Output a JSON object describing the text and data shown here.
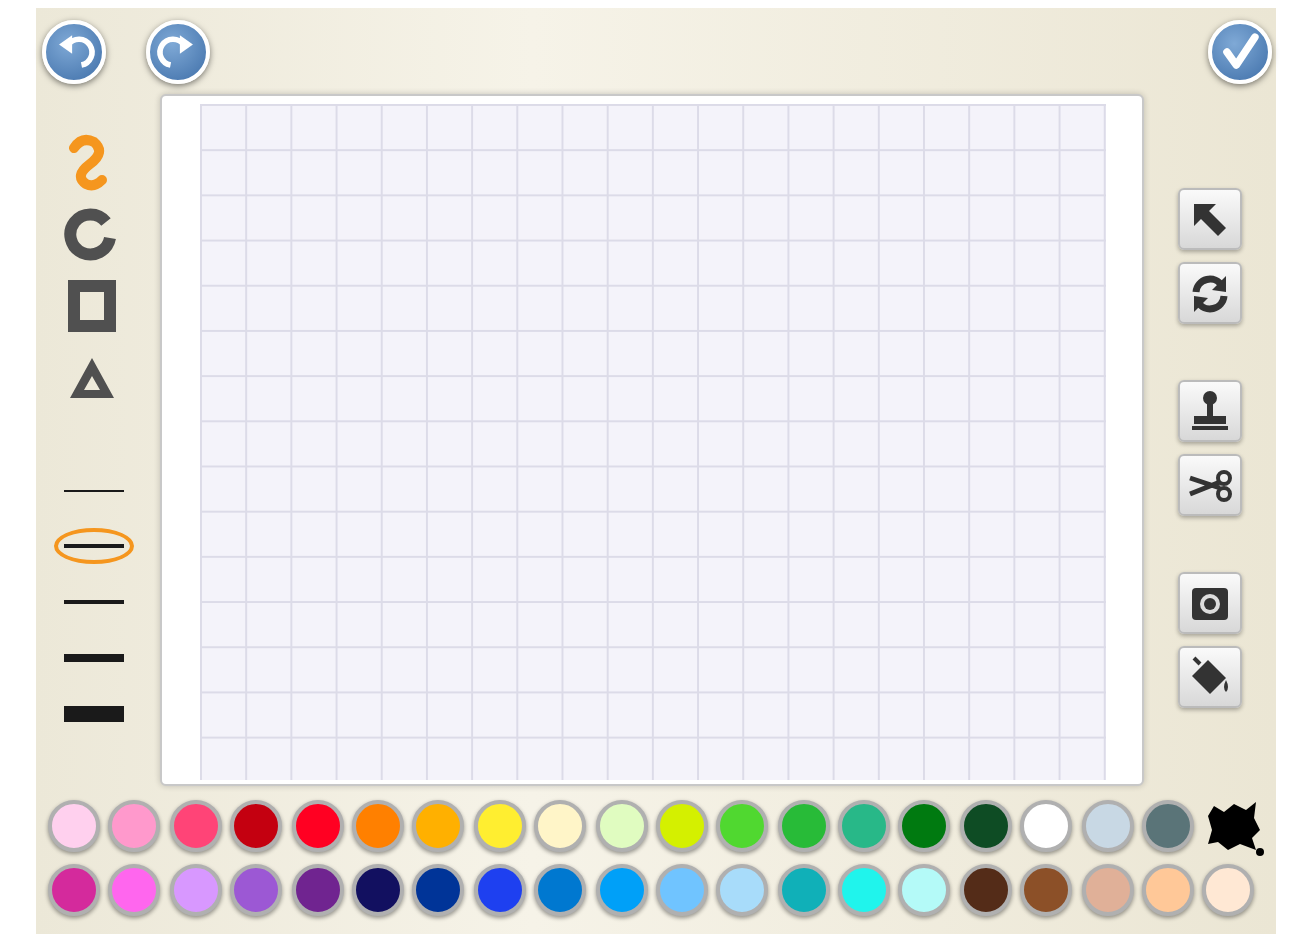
{
  "history_buttons": [
    {
      "kind": "undo"
    },
    {
      "kind": "redo"
    }
  ],
  "done_button": {
    "kind": "check"
  },
  "shape_tools": [
    {
      "kind": "freehand",
      "selected": true
    },
    {
      "kind": "circle",
      "selected": false
    },
    {
      "kind": "square",
      "selected": false
    },
    {
      "kind": "triangle",
      "selected": false
    }
  ],
  "line_widths": [
    {
      "kind": "hairline",
      "selected": false
    },
    {
      "kind": "thin",
      "selected": true
    },
    {
      "kind": "medium",
      "selected": false
    },
    {
      "kind": "thick",
      "selected": false
    },
    {
      "kind": "heavy",
      "selected": false
    }
  ],
  "edit_tools": [
    {
      "kind": "pointer"
    },
    {
      "kind": "rotate"
    },
    {
      "kind": "stamp"
    },
    {
      "kind": "scissors"
    },
    {
      "kind": "camera"
    },
    {
      "kind": "bucket"
    }
  ],
  "palette": [
    [
      {
        "color": "#ffd0ee"
      },
      {
        "color": "#ff99cc"
      },
      {
        "color": "#ff4477"
      },
      {
        "color": "#c40010"
      },
      {
        "color": "#ff0022"
      },
      {
        "color": "#ff8000"
      },
      {
        "color": "#ffb000"
      },
      {
        "color": "#ffee30"
      },
      {
        "color": "#fff5c8"
      },
      {
        "color": "#e0fcc0"
      },
      {
        "color": "#d4f000"
      },
      {
        "color": "#50d830"
      },
      {
        "color": "#28bb38"
      },
      {
        "color": "#28b888"
      },
      {
        "color": "#007a10"
      },
      {
        "color": "#0e4c24"
      },
      {
        "color": "#ffffff"
      },
      {
        "color": "#c8d8e4"
      },
      {
        "color": "#5a7478"
      },
      {
        "color": "#000000",
        "kind": "splat"
      }
    ],
    [
      {
        "color": "#d42a9c"
      },
      {
        "color": "#ff66ee"
      },
      {
        "color": "#d898ff"
      },
      {
        "color": "#9c58d4"
      },
      {
        "color": "#702490"
      },
      {
        "color": "#121060"
      },
      {
        "color": "#003498"
      },
      {
        "color": "#1e40f0"
      },
      {
        "color": "#0078d0"
      },
      {
        "color": "#00a0f8"
      },
      {
        "color": "#70c4ff"
      },
      {
        "color": "#a8dcfa"
      },
      {
        "color": "#10b0b8"
      },
      {
        "color": "#20f4ec"
      },
      {
        "color": "#b4faf8"
      },
      {
        "color": "#542c18"
      },
      {
        "color": "#8c5028"
      },
      {
        "color": "#e0b098"
      },
      {
        "color": "#ffc898"
      },
      {
        "color": "#ffe8d4"
      }
    ]
  ]
}
